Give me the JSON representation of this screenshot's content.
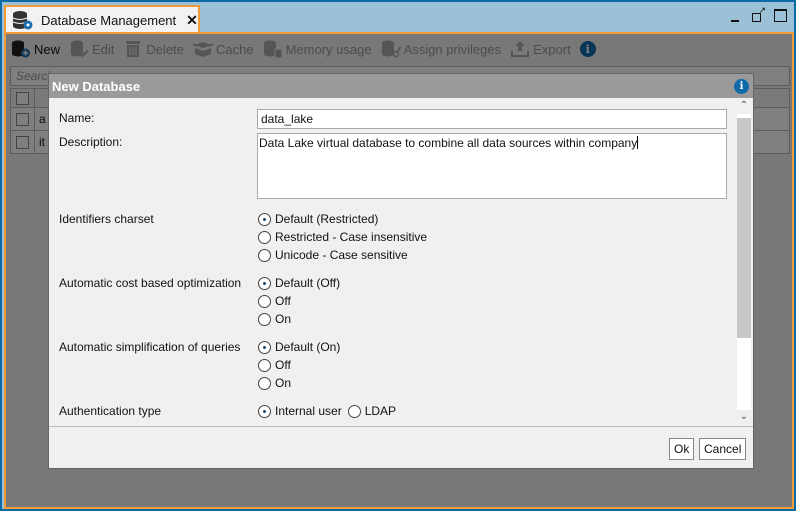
{
  "window": {
    "tab_title": "Database Management",
    "tab_close": "✕",
    "controls": [
      "minimize",
      "detach",
      "maximize"
    ]
  },
  "toolbar": {
    "buttons": [
      {
        "label": "New",
        "icon": "database-add-icon",
        "enabled": true
      },
      {
        "label": "Edit",
        "icon": "database-edit-icon",
        "enabled": false
      },
      {
        "label": "Delete",
        "icon": "trash-icon",
        "enabled": false
      },
      {
        "label": "Cache",
        "icon": "cache-icon",
        "enabled": false
      },
      {
        "label": "Memory usage",
        "icon": "database-memory-icon",
        "enabled": false
      },
      {
        "label": "Assign privileges",
        "icon": "database-key-icon",
        "enabled": false
      },
      {
        "label": "Export",
        "icon": "export-icon",
        "enabled": false
      }
    ],
    "info": "i"
  },
  "search": {
    "placeholder": "Search"
  },
  "grid": {
    "rows": [
      {
        "name": "a"
      },
      {
        "name": "it"
      }
    ]
  },
  "dialog": {
    "title": "New Database",
    "info": "i",
    "name_label": "Name:",
    "name_value": "data_lake",
    "description_label": "Description:",
    "description_value": "Data Lake virtual database to combine all data sources within company",
    "identifiers_charset": {
      "label": "Identifiers charset",
      "options": [
        "Default (Restricted)",
        "Restricted - Case insensitive",
        "Unicode - Case sensitive"
      ],
      "selected": "Default (Restricted)"
    },
    "cost_optimization": {
      "label": "Automatic cost based optimization",
      "options": [
        "Default (Off)",
        "Off",
        "On"
      ],
      "selected": "Default (Off)"
    },
    "query_simplification": {
      "label": "Automatic simplification of queries",
      "options": [
        "Default (On)",
        "Off",
        "On"
      ],
      "selected": "Default (On)"
    },
    "authentication": {
      "label": "Authentication type",
      "options": [
        "Internal user",
        "LDAP"
      ],
      "selected": "Internal user"
    },
    "ok_label": "Ok",
    "cancel_label": "Cancel",
    "scroll_up": "⌃",
    "scroll_down": "⌄"
  },
  "colors": {
    "accent_orange": "#f39a36",
    "frame_blue": "#0b6aa2",
    "info_blue": "#0e6aa8"
  }
}
